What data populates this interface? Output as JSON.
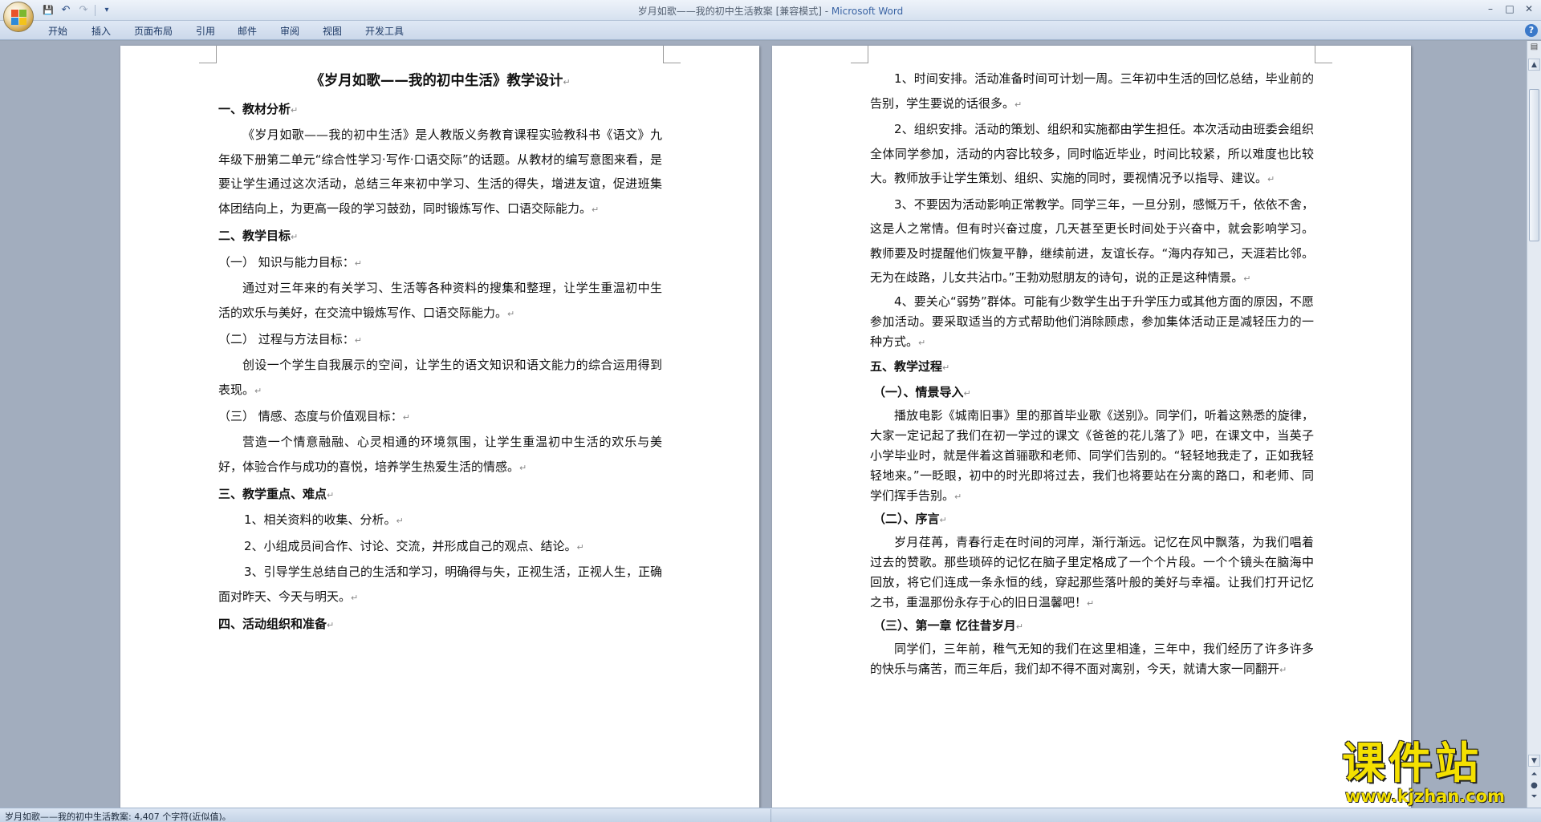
{
  "window": {
    "title_doc": "岁月如歌——我的初中生活教案 [兼容模式] - ",
    "title_app": "Microsoft Word",
    "controls": [
      "–",
      "□",
      "✕"
    ]
  },
  "quick_access": {
    "save_icon": "💾",
    "undo_icon": "↶",
    "redo_icon": "↷",
    "dropdown_icon": "▾"
  },
  "ribbon": {
    "tabs": [
      "开始",
      "插入",
      "页面布局",
      "引用",
      "邮件",
      "审阅",
      "视图",
      "开发工具"
    ],
    "help_icon": "?"
  },
  "page1": {
    "title": "《岁月如歌——我的初中生活》教学设计",
    "sections": [
      {
        "type": "h",
        "text": "一、教材分析"
      },
      {
        "type": "p",
        "text": "《岁月如歌——我的初中生活》是人教版义务教育课程实验教科书《语文》九年级下册第二单元“综合性学习·写作·口语交际”的话题。从教材的编写意图来看，是要让学生通过这次活动，总结三年来初中学习、生活的得失，增进友谊，促进班集体团结向上，为更高一段的学习鼓劲，同时锻炼写作、口语交际能力。"
      },
      {
        "type": "h",
        "text": "二、教学目标"
      },
      {
        "type": "s",
        "text": "（一）  知识与能力目标："
      },
      {
        "type": "p",
        "text": "通过对三年来的有关学习、生活等各种资料的搜集和整理，让学生重温初中生活的欢乐与美好，在交流中锻炼写作、口语交际能力。"
      },
      {
        "type": "s",
        "text": "（二）  过程与方法目标："
      },
      {
        "type": "p",
        "text": "创设一个学生自我展示的空间，让学生的语文知识和语文能力的综合运用得到表现。"
      },
      {
        "type": "s",
        "text": "（三）  情感、态度与价值观目标："
      },
      {
        "type": "p",
        "text": "营造一个情意融融、心灵相通的环境氛围，让学生重温初中生活的欢乐与美好，体验合作与成功的喜悦，培养学生热爱生活的情感。"
      },
      {
        "type": "h",
        "text": "三、教学重点、难点"
      },
      {
        "type": "l",
        "text": "1、相关资料的收集、分析。"
      },
      {
        "type": "l",
        "text": "2、小组成员间合作、讨论、交流，并形成自己的观点、结论。"
      },
      {
        "type": "l",
        "text": "3、引导学生总结自己的生活和学习，明确得与失，正视生活，正视人生，正确面对昨天、今天与明天。"
      },
      {
        "type": "h",
        "text": "四、活动组织和准备"
      }
    ]
  },
  "page2": {
    "sections": [
      {
        "type": "p",
        "text": "1、时间安排。活动准备时间可计划一周。三年初中生活的回忆总结，毕业前的告别，学生要说的话很多。"
      },
      {
        "type": "p",
        "text": "2、组织安排。活动的策划、组织和实施都由学生担任。本次活动由班委会组织全体同学参加，活动的内容比较多，同时临近毕业，时间比较紧，所以难度也比较大。教师放手让学生策划、组织、实施的同时，要视情况予以指导、建议。"
      },
      {
        "type": "p",
        "text": "3、不要因为活动影响正常教学。同学三年，一旦分别，感慨万千，依依不舍，这是人之常情。但有时兴奋过度，几天甚至更长时间处于兴奋中，就会影响学习。教师要及时提醒他们恢复平静，继续前进，友谊长存。“海内存知己，天涯若比邻。无为在歧路，儿女共沾巾。”王勃劝慰朋友的诗句，说的正是这种情景。"
      },
      {
        "type": "q",
        "text": "4、要关心“弱势”群体。可能有少数学生出于升学压力或其他方面的原因，不愿参加活动。要采取适当的方式帮助他们消除顾虑，参加集体活动正是减轻压力的一种方式。"
      },
      {
        "type": "h",
        "text": "五、教学过程"
      },
      {
        "type": "h2",
        "text": "（一）、情景导入"
      },
      {
        "type": "q",
        "text": "播放电影《城南旧事》里的那首毕业歌《送别》。同学们，听着这熟悉的旋律，大家一定记起了我们在初一学过的课文《爸爸的花儿落了》吧，在课文中，当英子小学毕业时，就是伴着这首骊歌和老师、同学们告别的。“轻轻地我走了，正如我轻轻地来。”一眨眼，初中的时光即将过去，我们也将要站在分离的路口，和老师、同学们挥手告别。"
      },
      {
        "type": "h2",
        "text": "（二）、序言"
      },
      {
        "type": "q",
        "text": "岁月荏苒，青春行走在时间的河岸，渐行渐远。记忆在风中飘落，为我们唱着过去的赞歌。那些琐碎的记忆在脑子里定格成了一个个片段。一个个镜头在脑海中回放，将它们连成一条永恒的线，穿起那些落叶般的美好与幸福。让我们打开记忆之书，重温那份永存于心的旧日温馨吧！"
      },
      {
        "type": "h2",
        "text": "（三）、第一章 忆往昔岁月"
      },
      {
        "type": "q",
        "text": "同学们，三年前，稚气无知的我们在这里相逢，三年中，我们经历了许多许多的快乐与痛苦，而三年后，我们却不得不面对离别，今天，就请大家一同翻开"
      }
    ]
  },
  "paragraph_mark": "↵",
  "status": {
    "text": "岁月如歌——我的初中生活教案: 4,407 个字符(近似值)。"
  },
  "watermark": {
    "brand": "课件站",
    "url": "www.kjzhan.com"
  }
}
